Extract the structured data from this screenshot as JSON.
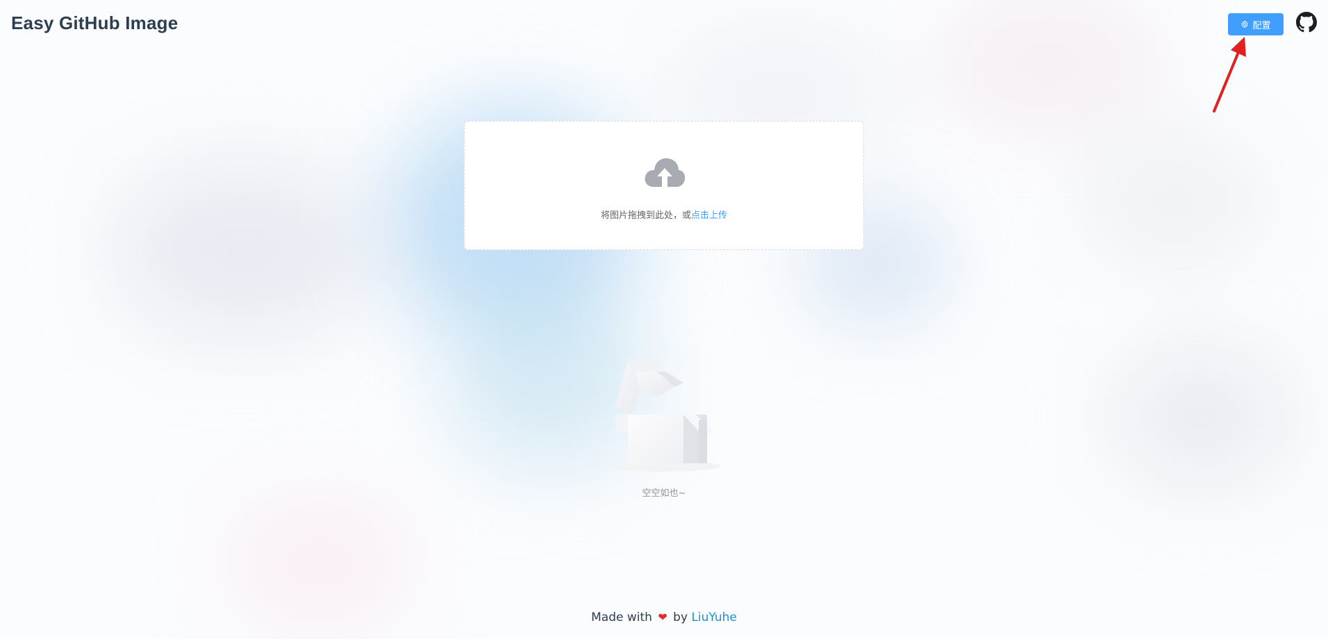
{
  "header": {
    "title": "Easy GitHub Image",
    "config_button": {
      "label": "配置",
      "icon": "gear-icon"
    },
    "github_link": {
      "icon": "github-icon"
    }
  },
  "upload": {
    "icon": "cloud-upload-icon",
    "prompt_text": "将图片拖拽到此处，或",
    "link_text": "点击上传"
  },
  "empty_state": {
    "icon": "empty-box-icon",
    "text": "空空如也~"
  },
  "footer": {
    "made_with": "Made with",
    "heart_icon": "heart-icon",
    "by": "by",
    "author": "LiuYuhe"
  },
  "colors": {
    "primary": "#409eff",
    "title": "#2c3e50",
    "annotation_arrow": "#e02020",
    "heart": "#e52b2b"
  }
}
